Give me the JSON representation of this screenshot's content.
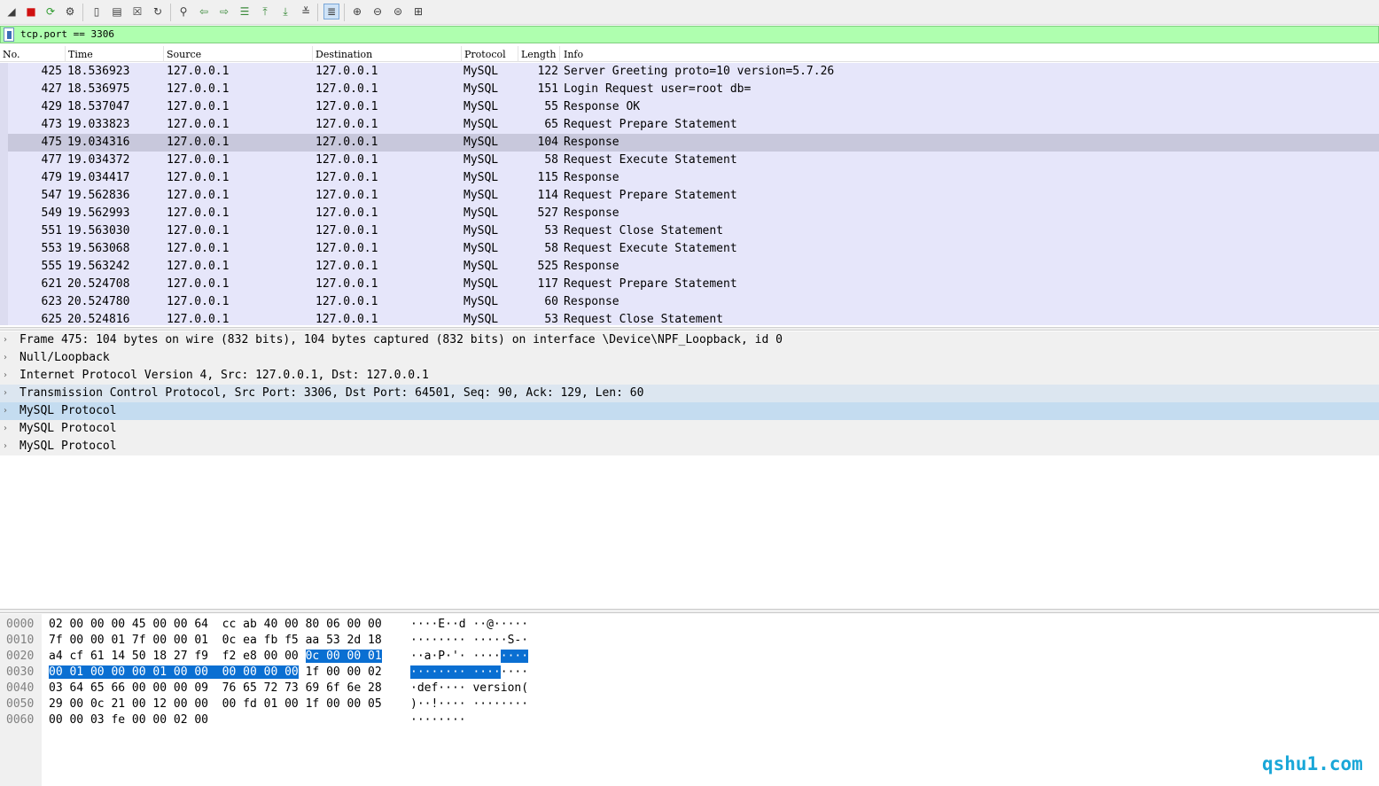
{
  "toolbar": {
    "icons": [
      "shark-fin-start-icon",
      "stop-icon",
      "restart-icon",
      "options-gear-icon",
      "open-file-icon",
      "save-file-icon",
      "close-file-icon",
      "reload-icon",
      "find-icon",
      "go-back-icon",
      "go-forward-icon",
      "go-to-packet-icon",
      "go-first-icon",
      "go-last-icon",
      "auto-scroll-icon",
      "colorize-icon",
      "zoom-in-icon",
      "zoom-out-icon",
      "normal-size-icon",
      "resize-columns-icon"
    ]
  },
  "filter": {
    "text": "tcp.port == 3306"
  },
  "packet_list": {
    "columns": [
      "No.",
      "Time",
      "Source",
      "Destination",
      "Protocol",
      "Length",
      "Info"
    ],
    "rows": [
      {
        "no": "425",
        "time": "18.536923",
        "src": "127.0.0.1",
        "dst": "127.0.0.1",
        "proto": "MySQL",
        "len": "122",
        "info": "Server Greeting proto=10 version=5.7.26"
      },
      {
        "no": "427",
        "time": "18.536975",
        "src": "127.0.0.1",
        "dst": "127.0.0.1",
        "proto": "MySQL",
        "len": "151",
        "info": "Login Request user=root db="
      },
      {
        "no": "429",
        "time": "18.537047",
        "src": "127.0.0.1",
        "dst": "127.0.0.1",
        "proto": "MySQL",
        "len": "55",
        "info": "Response OK"
      },
      {
        "no": "473",
        "time": "19.033823",
        "src": "127.0.0.1",
        "dst": "127.0.0.1",
        "proto": "MySQL",
        "len": "65",
        "info": "Request Prepare Statement"
      },
      {
        "no": "475",
        "time": "19.034316",
        "src": "127.0.0.1",
        "dst": "127.0.0.1",
        "proto": "MySQL",
        "len": "104",
        "info": "Response"
      },
      {
        "no": "477",
        "time": "19.034372",
        "src": "127.0.0.1",
        "dst": "127.0.0.1",
        "proto": "MySQL",
        "len": "58",
        "info": "Request Execute Statement"
      },
      {
        "no": "479",
        "time": "19.034417",
        "src": "127.0.0.1",
        "dst": "127.0.0.1",
        "proto": "MySQL",
        "len": "115",
        "info": "Response"
      },
      {
        "no": "547",
        "time": "19.562836",
        "src": "127.0.0.1",
        "dst": "127.0.0.1",
        "proto": "MySQL",
        "len": "114",
        "info": "Request Prepare Statement"
      },
      {
        "no": "549",
        "time": "19.562993",
        "src": "127.0.0.1",
        "dst": "127.0.0.1",
        "proto": "MySQL",
        "len": "527",
        "info": "Response"
      },
      {
        "no": "551",
        "time": "19.563030",
        "src": "127.0.0.1",
        "dst": "127.0.0.1",
        "proto": "MySQL",
        "len": "53",
        "info": "Request Close Statement"
      },
      {
        "no": "553",
        "time": "19.563068",
        "src": "127.0.0.1",
        "dst": "127.0.0.1",
        "proto": "MySQL",
        "len": "58",
        "info": "Request Execute Statement"
      },
      {
        "no": "555",
        "time": "19.563242",
        "src": "127.0.0.1",
        "dst": "127.0.0.1",
        "proto": "MySQL",
        "len": "525",
        "info": "Response"
      },
      {
        "no": "621",
        "time": "20.524708",
        "src": "127.0.0.1",
        "dst": "127.0.0.1",
        "proto": "MySQL",
        "len": "117",
        "info": "Request Prepare Statement"
      },
      {
        "no": "623",
        "time": "20.524780",
        "src": "127.0.0.1",
        "dst": "127.0.0.1",
        "proto": "MySQL",
        "len": "60",
        "info": "Response"
      },
      {
        "no": "625",
        "time": "20.524816",
        "src": "127.0.0.1",
        "dst": "127.0.0.1",
        "proto": "MySQL",
        "len": "53",
        "info": "Request Close Statement"
      }
    ],
    "selected_index": 4
  },
  "details": {
    "rows": [
      {
        "text": "Frame 475: 104 bytes on wire (832 bits), 104 bytes captured (832 bits) on interface \\Device\\NPF_Loopback, id 0",
        "state": "normal"
      },
      {
        "text": "Null/Loopback",
        "state": "normal"
      },
      {
        "text": "Internet Protocol Version 4, Src: 127.0.0.1, Dst: 127.0.0.1",
        "state": "normal"
      },
      {
        "text": "Transmission Control Protocol, Src Port: 3306, Dst Port: 64501, Seq: 90, Ack: 129, Len: 60",
        "state": "related"
      },
      {
        "text": "MySQL Protocol",
        "state": "selected"
      },
      {
        "text": "MySQL Protocol",
        "state": "normal"
      },
      {
        "text": "MySQL Protocol",
        "state": "normal"
      }
    ],
    "expander_glyph": "›"
  },
  "bytes": {
    "rows": [
      {
        "offset": "0000",
        "hex": [
          "02 00 00 00 45 00 00 64  cc ab 40 00 80 06 00 00",
          "",
          ""
        ],
        "ascii": [
          "····E··d ··@·····",
          "",
          ""
        ]
      },
      {
        "offset": "0010",
        "hex": [
          "7f 00 00 01 7f 00 00 01  0c ea fb f5 aa 53 2d 18",
          "",
          ""
        ],
        "ascii": [
          "········ ·····S-·",
          "",
          ""
        ]
      },
      {
        "offset": "0020",
        "hex": [
          "a4 cf 61 14 50 18 27 f9  f2 e8 00 00 ",
          "0c 00 00 01",
          ""
        ],
        "ascii": [
          "··a·P·'· ····",
          "····",
          ""
        ]
      },
      {
        "offset": "0030",
        "hex": [
          "",
          "00 01 00 00 00 01 00 00  00 00 00 00",
          " 1f 00 00 02"
        ],
        "ascii": [
          "",
          "········ ····",
          "····"
        ]
      },
      {
        "offset": "0040",
        "hex": [
          "03 64 65 66 00 00 00 09  76 65 72 73 69 6f 6e 28",
          "",
          ""
        ],
        "ascii": [
          "·def···· version(",
          "",
          ""
        ]
      },
      {
        "offset": "0050",
        "hex": [
          "29 00 0c 21 00 12 00 00  00 fd 01 00 1f 00 00 05",
          "",
          ""
        ],
        "ascii": [
          ")··!···· ········",
          "",
          ""
        ]
      },
      {
        "offset": "0060",
        "hex": [
          "00 00 03 fe 00 00 02 00",
          "",
          ""
        ],
        "ascii": [
          "········",
          "",
          ""
        ]
      }
    ]
  },
  "watermark": "qshu1.com",
  "colors": {
    "filter_bg": "#afffaf",
    "row_bg": "#e6e6fa",
    "row_selected": "#c8c8dc",
    "detail_selected": "#c4dcf0",
    "byte_highlight": "#0a6fd2",
    "watermark": "#1aa7d8"
  }
}
